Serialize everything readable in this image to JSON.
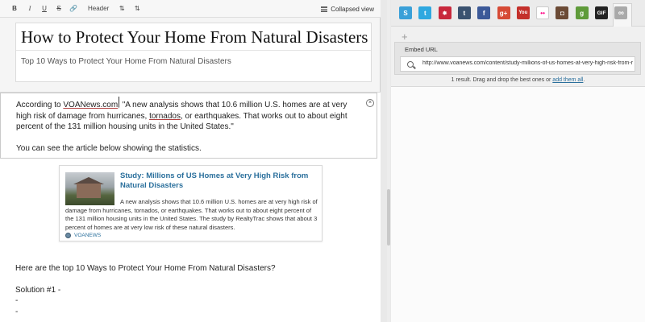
{
  "toolbar": {
    "bold": "B",
    "italic": "I",
    "underline": "U",
    "strike": "S",
    "link": "🔗",
    "header": "Header",
    "sort_asc": "⇅",
    "sort_desc": "⇅",
    "collapsed_view": "Collapsed view"
  },
  "post": {
    "title": "How to Protect Your Home From Natural Disasters",
    "subtitle": "Top 10 Ways to Protect Your Home From Natural Disasters"
  },
  "body": {
    "para1_pre": "According to ",
    "para1_link1": "VOANews.com",
    "para1_mid": ", \"A new analysis shows that 10.6 million U.S. homes are at very high risk of damage from hurricanes, ",
    "para1_link2": "tornados",
    "para1_post": ", or earthquakes. That works out to about eight percent of the 131 million housing units in the United States.\"",
    "para2": "You can see the article below showing the statistics.",
    "close_symbol": "×",
    "line_top10": "Here are the top 10 Ways to Protect Your Home From Natural Disasters?",
    "line_solution1": "Solution #1 -",
    "dash1": "-",
    "dash2": "-"
  },
  "embed": {
    "title": "Study: Millions of US Homes at Very High Risk from Natural Disasters",
    "description": "A new analysis shows that 10.6 million U.S. homes are at very high risk of damage from hurricanes, tornados, or earthquakes. That works out to about eight percent of the 131 million housing units in the United States. The study by RealtyTrac shows that about 3 percent of homes are at very low risk of these natural disasters.",
    "source": "VOANEWS"
  },
  "services": [
    {
      "name": "storify",
      "glyph": "S",
      "color": "#3aa0d8"
    },
    {
      "name": "twitter",
      "glyph": "t",
      "color": "#2fa8e0"
    },
    {
      "name": "facebook-like",
      "glyph": "✸",
      "color": "#c8283c"
    },
    {
      "name": "tumblr",
      "glyph": "t",
      "color": "#3a5270"
    },
    {
      "name": "facebook",
      "glyph": "f",
      "color": "#3b5998"
    },
    {
      "name": "google-plus",
      "glyph": "g+",
      "color": "#d64a35"
    },
    {
      "name": "youtube",
      "glyph": "You",
      "color": "#c4302b"
    },
    {
      "name": "flickr",
      "glyph": "••",
      "color": "#ffffff"
    },
    {
      "name": "instagram",
      "glyph": "◘",
      "color": "#6b4a35"
    },
    {
      "name": "google",
      "glyph": "g",
      "color": "#5f9b3a"
    },
    {
      "name": "gif",
      "glyph": "GIF",
      "color": "#222222"
    },
    {
      "name": "link",
      "glyph": "∞",
      "color": "#a9a9a9"
    }
  ],
  "right": {
    "add": "+",
    "embed_label": "Embed URL",
    "url_value": "http://www.voanews.com/content/study-millions-of-us-homes-at-very-high-risk-from-r",
    "result_text": "1 result. Drag and drop the best ones or ",
    "result_link": "add them all",
    "result_end": "."
  }
}
